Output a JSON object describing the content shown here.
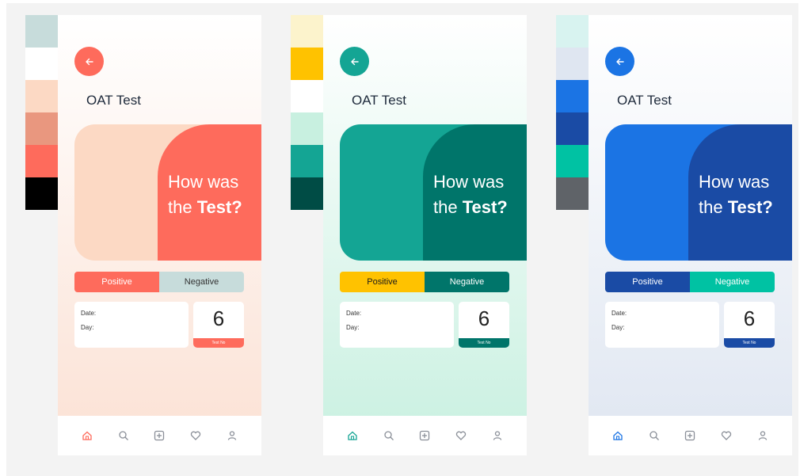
{
  "screens": [
    {
      "title": "OAT Test",
      "hero_line1": "How was",
      "hero_line2_prefix": "the ",
      "hero_line2_bold": "Test?",
      "positive_label": "Positive",
      "negative_label": "Negative",
      "date_label": "Date:",
      "day_label": "Day:",
      "test_number": "6",
      "test_number_label": "Test No",
      "nav_icons": [
        "home-icon",
        "search-icon",
        "add-icon",
        "heart-icon",
        "profile-icon"
      ],
      "palette": [
        "#c7dcdb",
        "#ffffff",
        "#fcd9c4",
        "#e9977f",
        "#fe6b5c",
        "#000000"
      ],
      "colors": {
        "accent": "#fe6b5c",
        "hero_left": "#fcd9c4",
        "hero_right": "#fe6b5c",
        "positive_bg": "#fe6b5c",
        "positive_text": "#ffffff",
        "negative_bg": "#c7dcdb",
        "negative_text": "#333333",
        "bg_top": "#ffffff",
        "bg_bottom": "#fbe1d4"
      }
    },
    {
      "title": "OAT Test",
      "hero_line1": "How was",
      "hero_line2_prefix": "the ",
      "hero_line2_bold": "Test?",
      "positive_label": "Positive",
      "negative_label": "Negative",
      "date_label": "Date:",
      "day_label": "Day:",
      "test_number": "6",
      "test_number_label": "Test No",
      "nav_icons": [
        "home-icon",
        "search-icon",
        "add-icon",
        "heart-icon",
        "profile-icon"
      ],
      "palette": [
        "#fcf3cc",
        "#ffc200",
        "#ffffff",
        "#c8f0e0",
        "#14a594",
        "#004c45"
      ],
      "colors": {
        "accent": "#14a594",
        "hero_left": "#14a594",
        "hero_right": "#00756a",
        "positive_bg": "#ffc200",
        "positive_text": "#1b1b1b",
        "negative_bg": "#00756a",
        "negative_text": "#ffffff",
        "bg_top": "#ffffff",
        "bg_bottom": "#c8f0e0"
      }
    },
    {
      "title": "OAT Test",
      "hero_line1": "How was",
      "hero_line2_prefix": "the ",
      "hero_line2_bold": "Test?",
      "positive_label": "Positive",
      "negative_label": "Negative",
      "date_label": "Date:",
      "day_label": "Day:",
      "test_number": "6",
      "test_number_label": "Test No",
      "nav_icons": [
        "home-icon",
        "search-icon",
        "add-icon",
        "heart-icon",
        "profile-icon"
      ],
      "palette": [
        "#d8f3f0",
        "#dfe6f1",
        "#1b74e4",
        "#1a4ba5",
        "#00c2a3",
        "#5f6368"
      ],
      "colors": {
        "accent": "#1b74e4",
        "hero_left": "#1b74e4",
        "hero_right": "#1a4ba5",
        "positive_bg": "#1a4ba5",
        "positive_text": "#ffffff",
        "negative_bg": "#00c2a3",
        "negative_text": "#ffffff",
        "bg_top": "#ffffff",
        "bg_bottom": "#dfe6f1"
      }
    }
  ]
}
